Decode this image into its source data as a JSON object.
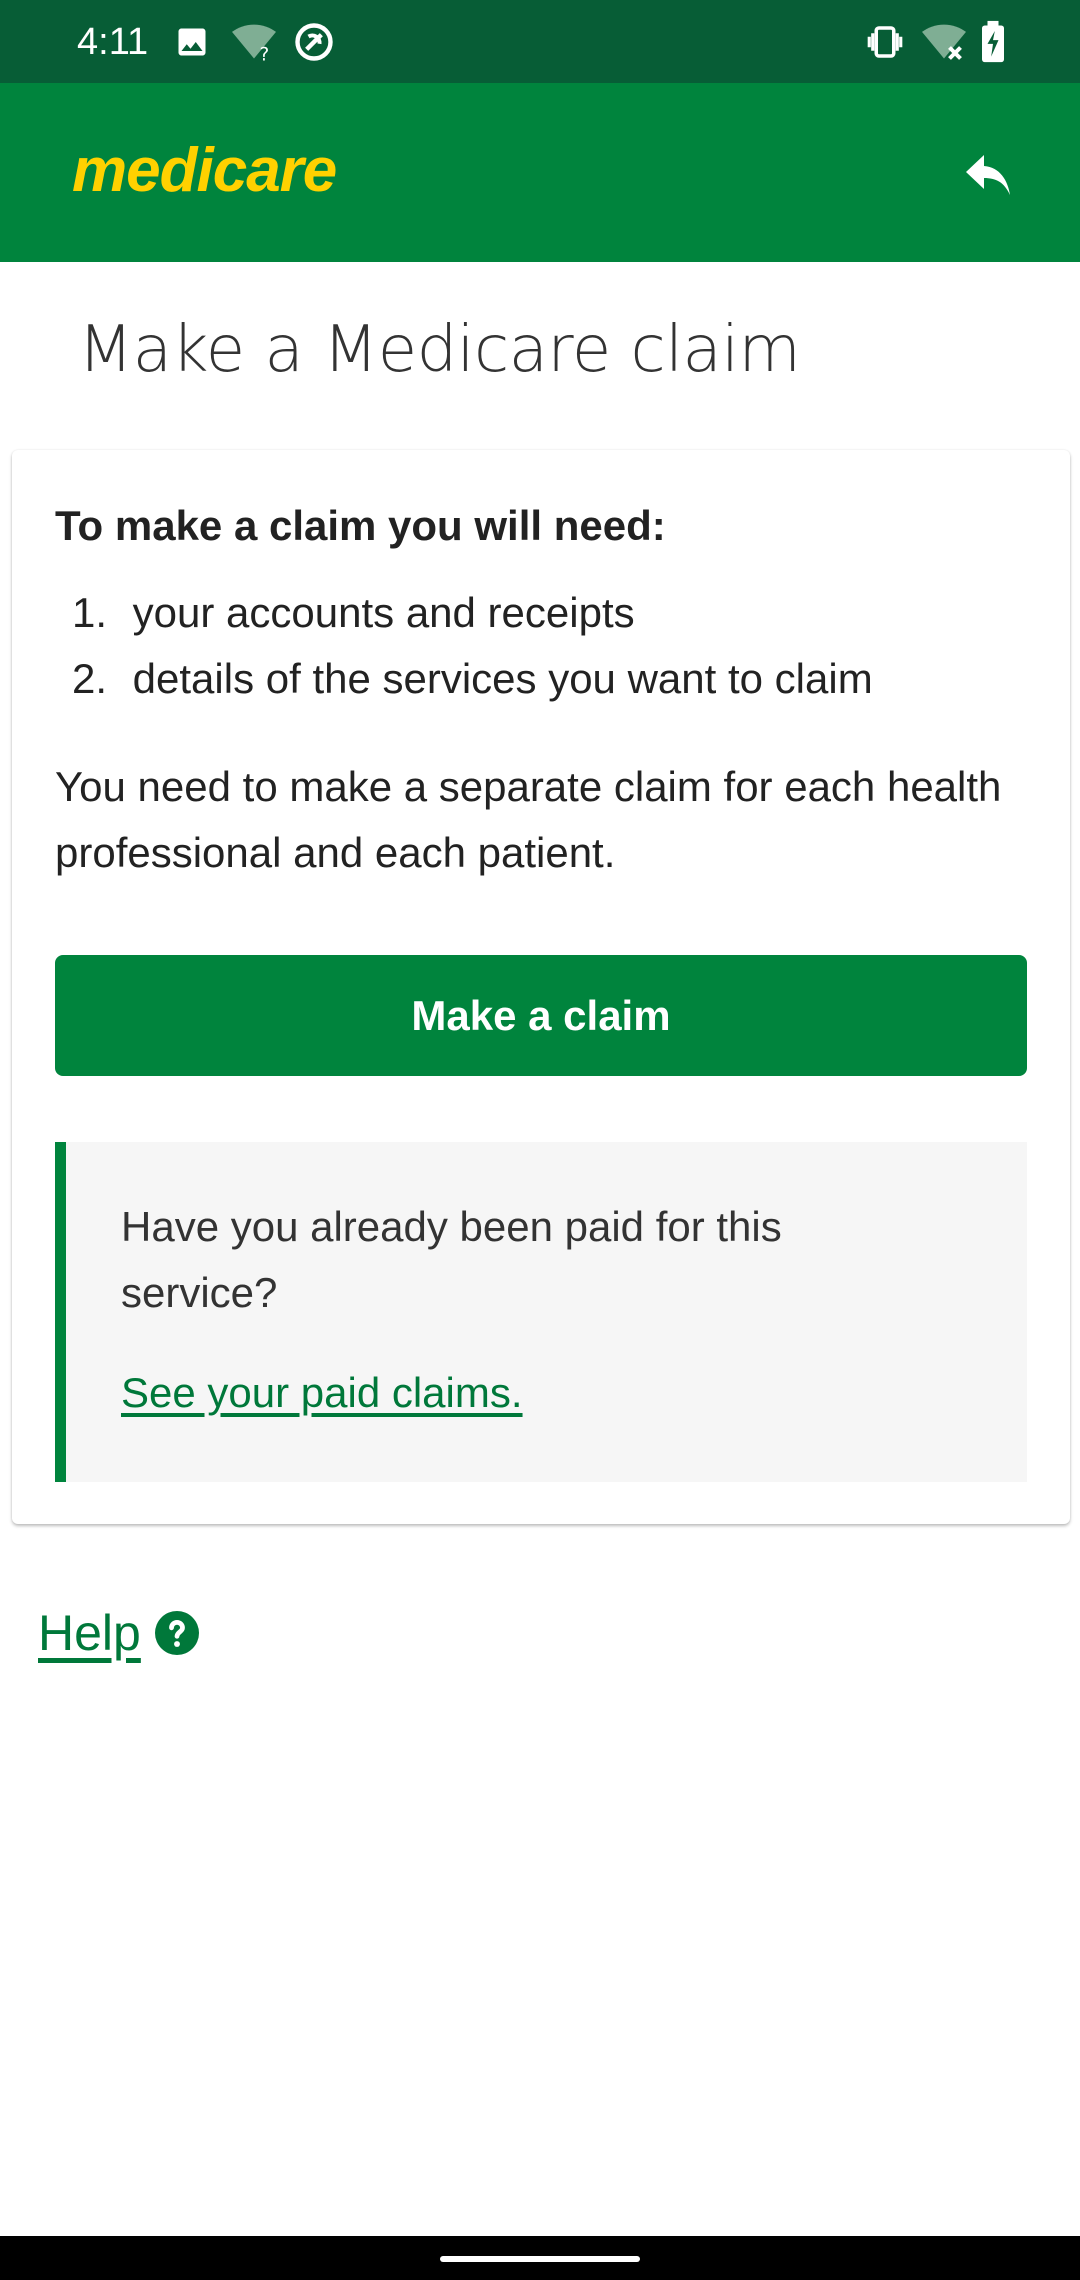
{
  "status_bar": {
    "time": "4:11",
    "left_icons": [
      "image-icon",
      "wifi-question-icon",
      "data-saver-icon"
    ],
    "right_icons": [
      "vibrate-icon",
      "wifi-off-icon",
      "battery-charging-icon"
    ]
  },
  "header": {
    "logo_text": "medicare",
    "back_icon": "reply-arrow-icon"
  },
  "page": {
    "title": "Make a Medicare claim"
  },
  "card": {
    "heading": "To make a claim you will need:",
    "requirements": [
      {
        "num": "1.",
        "text": "your accounts and receipts"
      },
      {
        "num": "2.",
        "text": "details of the services you want to claim"
      }
    ],
    "note": "You need to make a separate claim for each health professional and each patient.",
    "button_label": "Make a claim",
    "info": {
      "text": "Have you already been paid for this service?",
      "link": "See your paid claims."
    }
  },
  "help": {
    "label": "Help",
    "icon": "help-circle-icon"
  },
  "colors": {
    "status_bar": "#075d36",
    "brand_green": "#00843d",
    "logo_yellow": "#ffd100",
    "link_green": "#00783a",
    "info_bg": "#f6f6f6"
  }
}
